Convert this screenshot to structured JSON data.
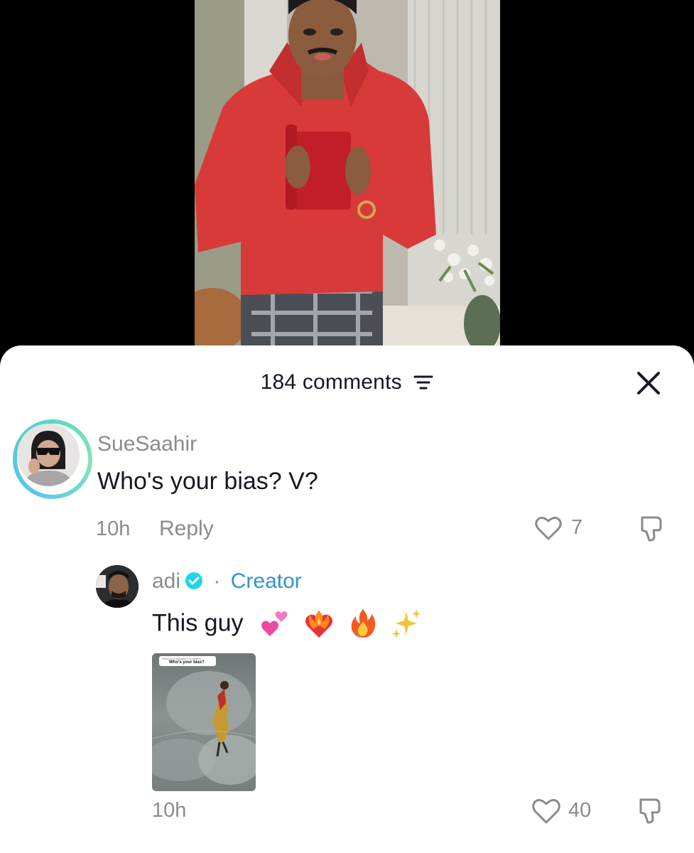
{
  "header": {
    "comments_count": "184 comments"
  },
  "comments": [
    {
      "username": "SueSaahir",
      "text": "Who's your bias? V?",
      "time": "10h",
      "reply_label": "Reply",
      "likes": "7"
    }
  ],
  "reply": {
    "username": "adi",
    "separator": "·",
    "creator_label": "Creator",
    "text": "This guy",
    "emojis": [
      "two-hearts",
      "heart-on-fire",
      "fire",
      "sparkles"
    ],
    "attachment": {
      "reply_to_line": "Reply to SueSaahir's comment",
      "question": "Who's your bias?"
    },
    "time": "10h",
    "likes": "40"
  },
  "colors": {
    "accent": "#2f93d3",
    "ring_start": "#59c4f0",
    "ring_end": "#86e3b6",
    "muted": "#8a8b91",
    "text": "#161823"
  }
}
